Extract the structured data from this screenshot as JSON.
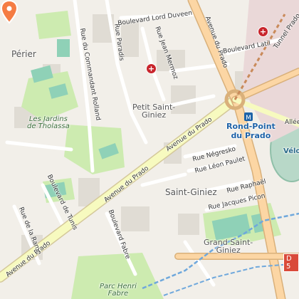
{
  "labels": {
    "perier": "Périer",
    "rue_du_commandant_rolland": "Rue du Commandant Rolland",
    "rue_paradis": "Rue Paradis",
    "boulevard_lord_duveen": "Boulevard Lord Duveen",
    "rue_jean_mermoz": "Rue Jean Mermoz",
    "avenue_du_prado_north": "Avenue du Prado",
    "tunnel_prado": "Tunnel Prado",
    "boulevard_latil": "Boulevard Latil",
    "petit_saint_giniez": "Petit Saint-\nGiniez",
    "les_jardins": "Les Jardins\nde Tholassa",
    "rond_point_du_prado": "Rond-Point\ndu Prado",
    "allee": "Allée",
    "velo": "Vélo",
    "avenue_du_prado_center": "Avenue du Prado",
    "avenue_du_prado_west": "Avenue du Prado",
    "rue_negresko": "Rue Négresko",
    "rue_leon_paulet": "Rue Léon Paulet",
    "saint_giniez": "Saint-Giniez",
    "rue_raphael": "Rue Raphaël",
    "rue_jacques_picon": "Rue Jacques Picon",
    "boulevard_de_tunis": "Boulevard de Tunis",
    "rue_de_la_rame": "Rue de la Rame",
    "boulevard_fabre": "Boulevard Fabre",
    "grand_saint_giniez": "Grand Saint-\nGiniez",
    "parc_henri_fabre": "Parc Henri\nFabre",
    "d5": "D 5"
  },
  "icons": {
    "location_pin": "map-pin",
    "hospital_1": "hospital-cross",
    "hospital_2": "hospital-cross",
    "metro": "metro-station"
  },
  "colors": {
    "background": "#f2efe9",
    "primary_road": "#f7fabf",
    "trunk_road": "#fcd6a4",
    "park": "#cdebb0",
    "sports_pitch": "#8fd1b7",
    "hospital": "#c8252c",
    "pin": "#f57c43",
    "water_path": "#6fa8dc"
  }
}
